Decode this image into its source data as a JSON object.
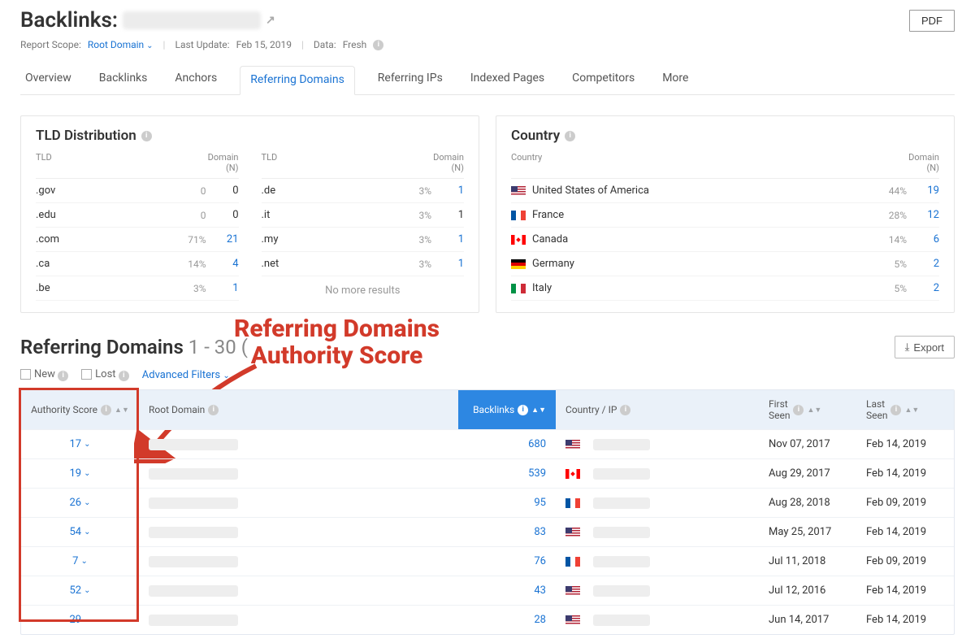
{
  "header": {
    "title_prefix": "Backlinks:",
    "pdf_label": "PDF",
    "scope_label": "Report Scope:",
    "scope_value": "Root Domain",
    "last_update_label": "Last Update:",
    "last_update_value": "Feb 15, 2019",
    "data_label": "Data:",
    "data_value": "Fresh"
  },
  "tabs": [
    "Overview",
    "Backlinks",
    "Anchors",
    "Referring Domains",
    "Referring IPs",
    "Indexed Pages",
    "Competitors",
    "More"
  ],
  "active_tab": "Referring Domains",
  "tld_panel": {
    "title": "TLD Distribution",
    "head_tld": "TLD",
    "head_n": "Domain (N)",
    "left": [
      {
        "tld": ".gov",
        "pct": "0",
        "n": "0",
        "link": false
      },
      {
        "tld": ".edu",
        "pct": "0",
        "n": "0",
        "link": false
      },
      {
        "tld": ".com",
        "pct": "71%",
        "n": "21",
        "link": true
      },
      {
        "tld": ".ca",
        "pct": "14%",
        "n": "4",
        "link": true
      },
      {
        "tld": ".be",
        "pct": "3%",
        "n": "1",
        "link": true
      }
    ],
    "right": [
      {
        "tld": ".de",
        "pct": "3%",
        "n": "1",
        "link": true
      },
      {
        "tld": ".it",
        "pct": "3%",
        "n": "1",
        "link": false
      },
      {
        "tld": ".my",
        "pct": "3%",
        "n": "1",
        "link": true
      },
      {
        "tld": ".net",
        "pct": "3%",
        "n": "1",
        "link": true
      }
    ],
    "no_more": "No more results"
  },
  "country_panel": {
    "title": "Country",
    "head_country": "Country",
    "head_n": "Domain (N)",
    "rows": [
      {
        "flag": "us",
        "name": "United States of America",
        "pct": "44%",
        "n": "19"
      },
      {
        "flag": "fr",
        "name": "France",
        "pct": "28%",
        "n": "12"
      },
      {
        "flag": "ca",
        "name": "Canada",
        "pct": "14%",
        "n": "6"
      },
      {
        "flag": "de",
        "name": "Germany",
        "pct": "5%",
        "n": "2"
      },
      {
        "flag": "it",
        "name": "Italy",
        "pct": "5%",
        "n": "2"
      }
    ]
  },
  "section": {
    "title": "Referring Domains",
    "range": "1 - 30 (",
    "export_label": "Export",
    "filters": {
      "new": "New",
      "lost": "Lost",
      "advanced": "Advanced Filters"
    }
  },
  "annotation": {
    "line1": "Referring Domains",
    "line2": "Authority Score"
  },
  "table": {
    "headers": {
      "authority": "Authority Score",
      "root": "Root Domain",
      "backlinks": "Backlinks",
      "country": "Country / IP",
      "first_seen": "First\nSeen",
      "last_seen": "Last\nSeen"
    },
    "rows": [
      {
        "auth": "17",
        "back": "680",
        "flag": "us",
        "first": "Nov 07, 2017",
        "last": "Feb 14, 2019"
      },
      {
        "auth": "19",
        "back": "539",
        "flag": "ca",
        "first": "Aug 29, 2017",
        "last": "Feb 14, 2019"
      },
      {
        "auth": "26",
        "back": "95",
        "flag": "fr",
        "first": "Aug 28, 2018",
        "last": "Feb 09, 2019"
      },
      {
        "auth": "54",
        "back": "83",
        "flag": "us",
        "first": "May 25, 2017",
        "last": "Feb 14, 2019"
      },
      {
        "auth": "7",
        "back": "76",
        "flag": "fr",
        "first": "Jul 11, 2018",
        "last": "Feb 09, 2019"
      },
      {
        "auth": "52",
        "back": "43",
        "flag": "us",
        "first": "Jul 12, 2016",
        "last": "Feb 14, 2019"
      },
      {
        "auth": "29",
        "back": "28",
        "flag": "us",
        "first": "Jun 14, 2017",
        "last": "Feb 14, 2019"
      }
    ]
  }
}
